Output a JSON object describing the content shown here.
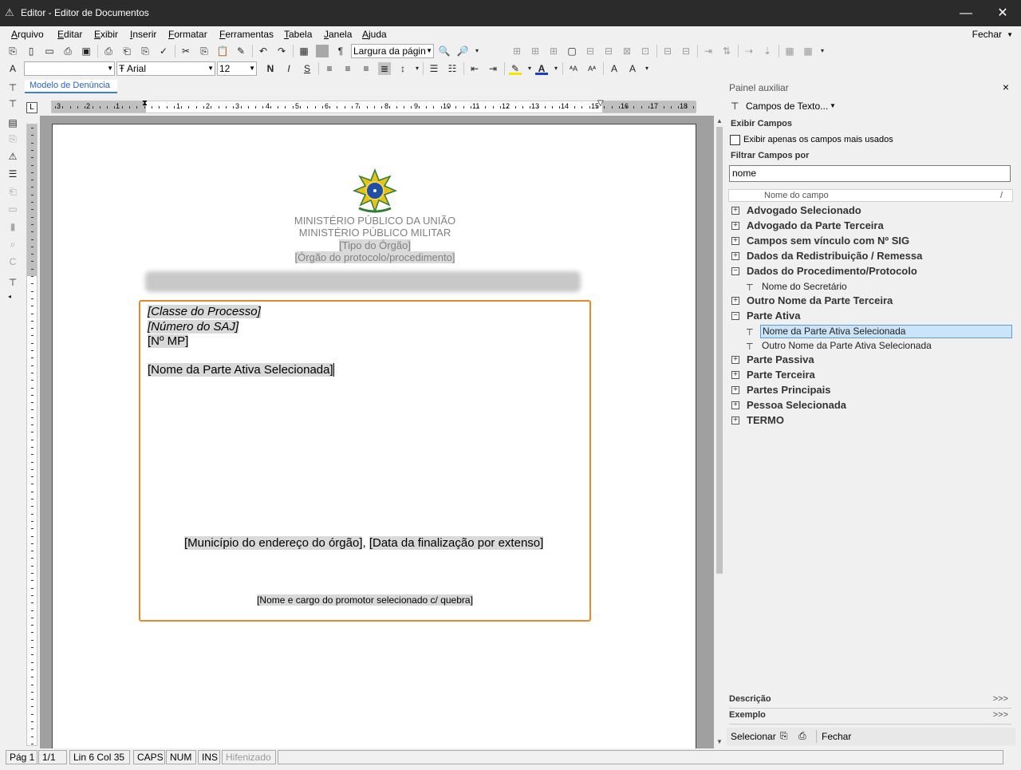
{
  "window": {
    "title": "Editor - Editor de Documentos",
    "minimize": "—",
    "close": "✕"
  },
  "menu": {
    "items": [
      "Arquivo",
      "Editar",
      "Exibir",
      "Inserir",
      "Formatar",
      "Ferramentas",
      "Tabela",
      "Janela",
      "Ajuda"
    ],
    "close_label": "Fechar"
  },
  "toolbar": {
    "zoom_value": "Largura da págin",
    "style_value": "",
    "font_value": "Arial",
    "size_value": "12",
    "bold": "N",
    "italic": "I",
    "underline": "S"
  },
  "doc_tab": "Modelo de Denúncia",
  "ruler": {
    "numbers": [
      "3",
      "2",
      "1",
      "1",
      "2",
      "3",
      "4",
      "5",
      "6",
      "7",
      "8",
      "9",
      "10",
      "11",
      "12",
      "13",
      "14",
      "15",
      "16",
      "17",
      "18"
    ]
  },
  "document": {
    "header_line1": "MINISTÉRIO PÚBLICO DA UNIÃO",
    "header_line2": "MINISTÉRIO PÚBLICO MILITAR",
    "header_line3": "[Tipo do Órgão]",
    "header_line4": "[Órgão do protocolo/procedimento]",
    "line_classe": "[Classe do Processo]",
    "line_numero": "[Número do SAJ]",
    "line_mp": "[Nº MP]",
    "line_parte": "[Nome da Parte Ativa Selecionada]",
    "municipio": "[Município do endereço do órgão]",
    "comma": ", ",
    "data": "[Data da finalização por extenso]",
    "promotor": "[Nome e cargo do promotor selecionado c/ quebra]"
  },
  "aux_panel": {
    "title": "Painel auxiliar",
    "close": "×",
    "fields_dropdown": "Campos de Texto...",
    "exibir_campos": "Exibir Campos",
    "checkbox_label": "Exibir apenas os campos mais usados",
    "filtrar": "Filtrar Campos por",
    "filter_value": "nome",
    "tree_header": "Nome do campo",
    "tree_header_sort": "/",
    "groups": [
      "Advogado Selecionado",
      "Advogado da Parte Terceira",
      "Campos sem vínculo com Nº SIG",
      "Dados da Redistribuição / Remessa",
      "Dados do Procedimento/Protocolo",
      "Nome do Secretário",
      "Outro Nome da Parte Terceira",
      "Parte Ativa",
      "Nome da Parte Ativa Selecionada",
      "Outro Nome da Parte Ativa Selecionada",
      "Parte Passiva",
      "Parte Terceira",
      "Partes Principais",
      "Pessoa Selecionada",
      "TERMO"
    ],
    "descricao": "Descrição",
    "exemplo": "Exemplo",
    "more": ">>>",
    "selecionar": "Selecionar",
    "fechar": "Fechar"
  },
  "status": {
    "pag": "Pág 1",
    "pages": "1/1",
    "pos": "Lin 6  Col 35",
    "caps": "CAPS",
    "num": "NUM",
    "ins": "INS",
    "hif": "Hifenizado"
  },
  "colors": {
    "accent": "#e8872b",
    "selection": "#cce4f7",
    "titlebar": "#2b2b2b"
  }
}
